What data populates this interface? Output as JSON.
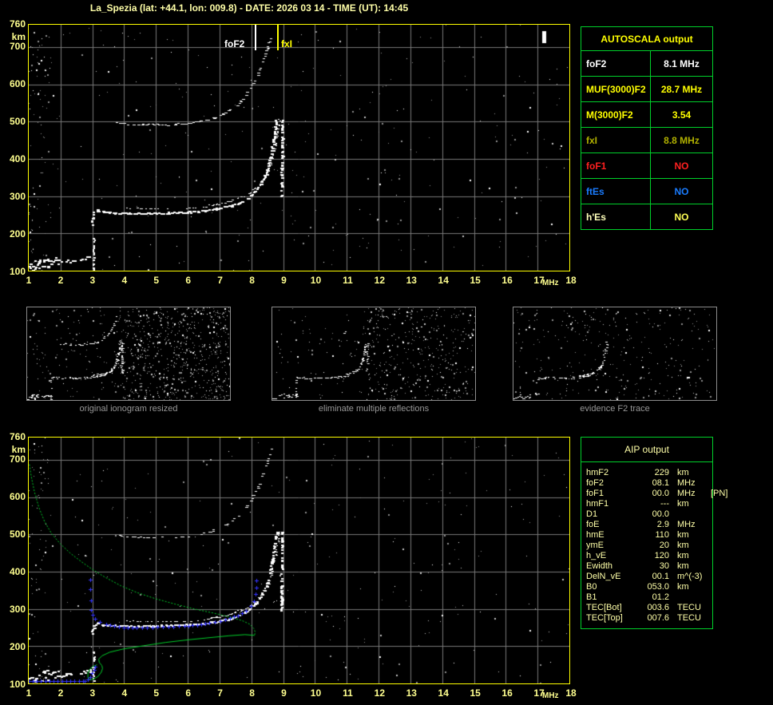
{
  "title": "La_Spezia (lat: +44.1, lon: 009.8) - DATE: 2026 03 14 - TIME (UT): 14:45",
  "colors": {
    "background": "#000000",
    "axis_yellow": "#ffff8f",
    "plot_border": "#ffff00",
    "grid": "#787878",
    "table_border": "#00d02a",
    "header_yellow": "#ffff00",
    "pale_yellow": "#ffffa8",
    "white": "#ffffff",
    "olive": "#b0b000",
    "red": "#ff2020",
    "blue": "#1a7cff",
    "profile_green": "#00d02a",
    "restored_blue": "#3434ff",
    "caption_gray": "#989898"
  },
  "autoscala_table": {
    "header": "AUTOSCALA output",
    "rows": [
      {
        "label": "foF2",
        "value": "8.1 MHz",
        "color": "#ffffff"
      },
      {
        "label": "MUF(3000)F2",
        "value": "28.7 MHz",
        "color": "#ffff00"
      },
      {
        "label": "M(3000)F2",
        "value": "3.54",
        "color": "#ffff00"
      },
      {
        "label": "fxI",
        "value": "8.8 MHz",
        "color": "#b0b000"
      },
      {
        "label": "foF1",
        "value": "NO",
        "color": "#ff2020"
      },
      {
        "label": "ftEs",
        "value": "NO",
        "color": "#1a7cff"
      },
      {
        "label": "h'Es",
        "value": "NO",
        "color": "#ffffbb",
        "value_color": "#ffff55"
      }
    ]
  },
  "aip_table": {
    "header": "AIP output",
    "rows": [
      {
        "label": "hmF2",
        "value": "229",
        "unit": "km",
        "extra": ""
      },
      {
        "label": "foF2",
        "value": "08.1",
        "unit": "MHz",
        "extra": ""
      },
      {
        "label": "foF1",
        "value": "00.0",
        "unit": "MHz",
        "extra": "[PN]"
      },
      {
        "label": "hmF1",
        "value": "---",
        "unit": "km",
        "extra": ""
      },
      {
        "label": "D1",
        "value": "00.0",
        "unit": "",
        "extra": ""
      },
      {
        "label": "foE",
        "value": "2.9",
        "unit": "MHz",
        "extra": ""
      },
      {
        "label": "hmE",
        "value": "110",
        "unit": "km",
        "extra": ""
      },
      {
        "label": "ymE",
        "value": "20",
        "unit": "km",
        "extra": ""
      },
      {
        "label": "h_vE",
        "value": "120",
        "unit": "km",
        "extra": ""
      },
      {
        "label": "Ewidth",
        "value": "30",
        "unit": "km",
        "extra": ""
      },
      {
        "label": "DelN_vE",
        "value": "00.1",
        "unit": "m^(-3)",
        "extra": ""
      },
      {
        "label": "B0",
        "value": "053.0",
        "unit": "km",
        "extra": ""
      },
      {
        "label": "B1",
        "value": "01.2",
        "unit": "",
        "extra": ""
      },
      {
        "label": "TEC[Bot]",
        "value": "003.6",
        "unit": "TECU",
        "extra": ""
      },
      {
        "label": "TEC[Top]",
        "value": "007.6",
        "unit": "TECU",
        "extra": ""
      }
    ]
  },
  "thumbnails": [
    {
      "caption": "original ionogram resized"
    },
    {
      "caption": "eliminate multiple reflections"
    },
    {
      "caption": "evidence F2 trace"
    }
  ],
  "chart_data": [
    {
      "id": "top_ionogram",
      "type": "scatter",
      "title": "autoscaled ionogram",
      "xlabel": "MHz",
      "ylabel": "km",
      "x_range": [
        1,
        18
      ],
      "y_range": [
        100,
        760
      ],
      "x_ticks": [
        1,
        2,
        3,
        4,
        5,
        6,
        7,
        8,
        9,
        10,
        11,
        12,
        13,
        14,
        15,
        16,
        17,
        18
      ],
      "y_ticks": [
        760,
        700,
        600,
        500,
        400,
        300,
        200,
        100
      ],
      "grid": true,
      "markers": [
        {
          "label": "foF2",
          "x_mhz": 8.1,
          "color": "#ffffff"
        },
        {
          "label": "fxI",
          "x_mhz": 8.8,
          "color": "#ffff00"
        }
      ],
      "traces": {
        "f2": [
          [
            2.98,
            225
          ],
          [
            3.0,
            240
          ],
          [
            3.05,
            256
          ],
          [
            3.15,
            262
          ],
          [
            3.35,
            257
          ],
          [
            3.7,
            255
          ],
          [
            4.2,
            254
          ],
          [
            4.8,
            254
          ],
          [
            5.4,
            255
          ],
          [
            6.0,
            257
          ],
          [
            6.5,
            261
          ],
          [
            6.9,
            266
          ],
          [
            7.3,
            273
          ],
          [
            7.6,
            282
          ],
          [
            7.9,
            296
          ],
          [
            8.1,
            312
          ],
          [
            8.3,
            334
          ],
          [
            8.45,
            360
          ],
          [
            8.55,
            390
          ],
          [
            8.65,
            430
          ],
          [
            8.72,
            470
          ],
          [
            8.77,
            505
          ]
        ],
        "f2_double": [
          [
            4.1,
            267
          ],
          [
            4.8,
            266
          ],
          [
            5.6,
            266
          ],
          [
            6.3,
            268
          ]
        ],
        "f2x": [
          [
            6.5,
            272
          ],
          [
            6.9,
            277
          ],
          [
            7.3,
            285
          ],
          [
            7.7,
            297
          ],
          [
            8.0,
            312
          ],
          [
            8.25,
            330
          ],
          [
            8.45,
            355
          ],
          [
            8.6,
            385
          ],
          [
            8.72,
            425
          ],
          [
            8.82,
            470
          ],
          [
            8.88,
            505
          ]
        ],
        "f2x_vert": [
          [
            8.93,
            295
          ],
          [
            8.94,
            360
          ],
          [
            8.95,
            420
          ],
          [
            8.96,
            505
          ]
        ],
        "hop2": [
          [
            3.75,
            498
          ],
          [
            4.1,
            494
          ],
          [
            4.6,
            491
          ],
          [
            5.1,
            491
          ],
          [
            5.6,
            492
          ],
          [
            6.0,
            495
          ],
          [
            6.4,
            501
          ],
          [
            6.8,
            510
          ],
          [
            7.1,
            521
          ],
          [
            7.4,
            536
          ],
          [
            7.65,
            555
          ],
          [
            7.85,
            577
          ],
          [
            8.05,
            603
          ],
          [
            8.2,
            630
          ],
          [
            8.35,
            662
          ],
          [
            8.5,
            697
          ],
          [
            8.6,
            728
          ]
        ],
        "e_trace": [
          [
            1.05,
            104
          ],
          [
            1.2,
            107
          ],
          [
            1.4,
            110
          ],
          [
            1.6,
            113
          ],
          [
            1.8,
            117
          ],
          [
            2.0,
            121
          ],
          [
            2.15,
            124
          ],
          [
            2.3,
            126
          ],
          [
            2.45,
            128
          ],
          [
            2.6,
            129
          ],
          [
            2.75,
            131
          ],
          [
            2.9,
            134
          ],
          [
            3.0,
            140
          ]
        ],
        "e_cluster": [
          [
            1.0,
            112
          ],
          [
            1.15,
            118
          ],
          [
            1.3,
            124
          ],
          [
            1.45,
            128
          ],
          [
            1.6,
            130
          ],
          [
            1.75,
            127
          ],
          [
            1.9,
            131
          ]
        ],
        "e_vert": [
          [
            3.02,
            102
          ],
          [
            3.03,
            130
          ],
          [
            3.04,
            160
          ],
          [
            3.05,
            186
          ]
        ]
      },
      "bright_spots": [
        {
          "f": 17.17,
          "km": 742,
          "w": 5,
          "h": 15
        }
      ]
    },
    {
      "id": "bottom_ionogram",
      "type": "scatter",
      "title": "restored trace and electron density profile",
      "xlabel": "MHz",
      "ylabel": "km",
      "x_range": [
        1,
        18
      ],
      "y_range": [
        100,
        760
      ],
      "x_ticks": [
        1,
        2,
        3,
        4,
        5,
        6,
        7,
        8,
        9,
        10,
        11,
        12,
        13,
        14,
        15,
        16,
        17,
        18
      ],
      "y_ticks": [
        760,
        700,
        600,
        500,
        400,
        300,
        200,
        100
      ],
      "grid": true,
      "profile_topside": [
        [
          1.02,
          688
        ],
        [
          1.08,
          655
        ],
        [
          1.18,
          614
        ],
        [
          1.32,
          572
        ],
        [
          1.5,
          534
        ],
        [
          1.72,
          502
        ],
        [
          2.0,
          474
        ],
        [
          2.3,
          450
        ],
        [
          2.65,
          427
        ],
        [
          3.0,
          406
        ],
        [
          3.4,
          385
        ],
        [
          3.9,
          362
        ],
        [
          4.4,
          344
        ],
        [
          5.0,
          327
        ],
        [
          5.6,
          313
        ],
        [
          6.2,
          300
        ],
        [
          6.8,
          289
        ],
        [
          7.3,
          279
        ],
        [
          7.7,
          269
        ],
        [
          7.95,
          259
        ],
        [
          8.08,
          247
        ],
        [
          8.12,
          238
        ],
        [
          8.1,
          229
        ]
      ],
      "profile_bottomside": [
        [
          8.1,
          229
        ],
        [
          7.8,
          231
        ],
        [
          7.3,
          228
        ],
        [
          6.7,
          223
        ],
        [
          6.0,
          217
        ],
        [
          5.3,
          210
        ],
        [
          4.6,
          201
        ],
        [
          4.0,
          193
        ],
        [
          3.55,
          184
        ],
        [
          3.3,
          174
        ],
        [
          3.2,
          165
        ],
        [
          3.22,
          156
        ],
        [
          3.3,
          148
        ],
        [
          3.32,
          140
        ],
        [
          3.28,
          130
        ],
        [
          3.18,
          119
        ],
        [
          3.05,
          112
        ],
        [
          2.93,
          110
        ],
        [
          2.86,
          116
        ],
        [
          2.86,
          127
        ],
        [
          2.92,
          138
        ],
        [
          3.02,
          146
        ],
        [
          3.15,
          150
        ]
      ],
      "restored_e": [
        [
          1.0,
          105
        ],
        [
          2.72,
          105
        ],
        [
          2.78,
          106
        ],
        [
          2.86,
          110
        ],
        [
          2.94,
          117
        ],
        [
          3.0,
          126
        ],
        [
          3.06,
          136
        ],
        [
          3.1,
          145
        ]
      ],
      "restored_f_vert": [
        [
          2.95,
          378
        ],
        [
          2.95,
          352
        ],
        [
          2.96,
          322
        ],
        [
          2.96,
          296
        ]
      ],
      "restored_f": [
        [
          3.02,
          283
        ],
        [
          3.1,
          272
        ],
        [
          3.25,
          263
        ],
        [
          3.45,
          257
        ],
        [
          3.7,
          253
        ],
        [
          4.0,
          250
        ],
        [
          4.4,
          249
        ],
        [
          4.9,
          250
        ],
        [
          5.4,
          251
        ],
        [
          5.9,
          253
        ],
        [
          6.3,
          256
        ],
        [
          6.7,
          261
        ],
        [
          7.05,
          267
        ],
        [
          7.35,
          274
        ],
        [
          7.6,
          282
        ],
        [
          7.85,
          294
        ],
        [
          8.0,
          306
        ],
        [
          8.1,
          320
        ],
        [
          8.14,
          338
        ],
        [
          8.16,
          356
        ],
        [
          8.18,
          375
        ]
      ],
      "echo_traces_same_as_top": true
    }
  ]
}
